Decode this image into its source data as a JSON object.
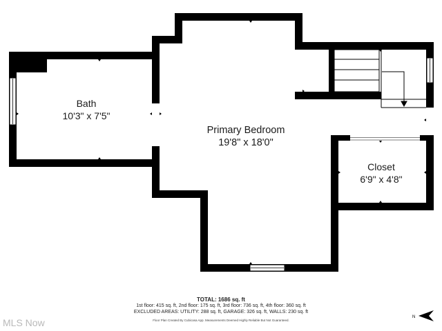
{
  "rooms": {
    "bath": {
      "name": "Bath",
      "dimensions": "10'3\" x 7'5\""
    },
    "primary_bedroom": {
      "name": "Primary Bedroom",
      "dimensions": "19'8\" x 18'0\""
    },
    "closet": {
      "name": "Closet",
      "dimensions": "6'9\" x 4'8\""
    }
  },
  "summary": {
    "total": "TOTAL: 1686 sq. ft",
    "floors": "1st floor: 415 sq. ft, 2nd floor: 175 sq. ft, 3rd floor: 736 sq. ft, 4th floor: 360 sq. ft",
    "excluded": "EXCLUDED AREAS: UTILITY: 288 sq. ft, GARAGE: 326 sq. ft, WALLS: 230 sq. ft",
    "disclaimer": "Floor Plan Created By Cubicasa App. Measurements Deemed Highly Reliable But Not Guaranteed."
  },
  "watermark": "MLS Now",
  "compass_label": "N",
  "colors": {
    "wall": "#000000",
    "background": "#ffffff",
    "window": "#ffffff",
    "watermark": "#b9b9b9"
  }
}
